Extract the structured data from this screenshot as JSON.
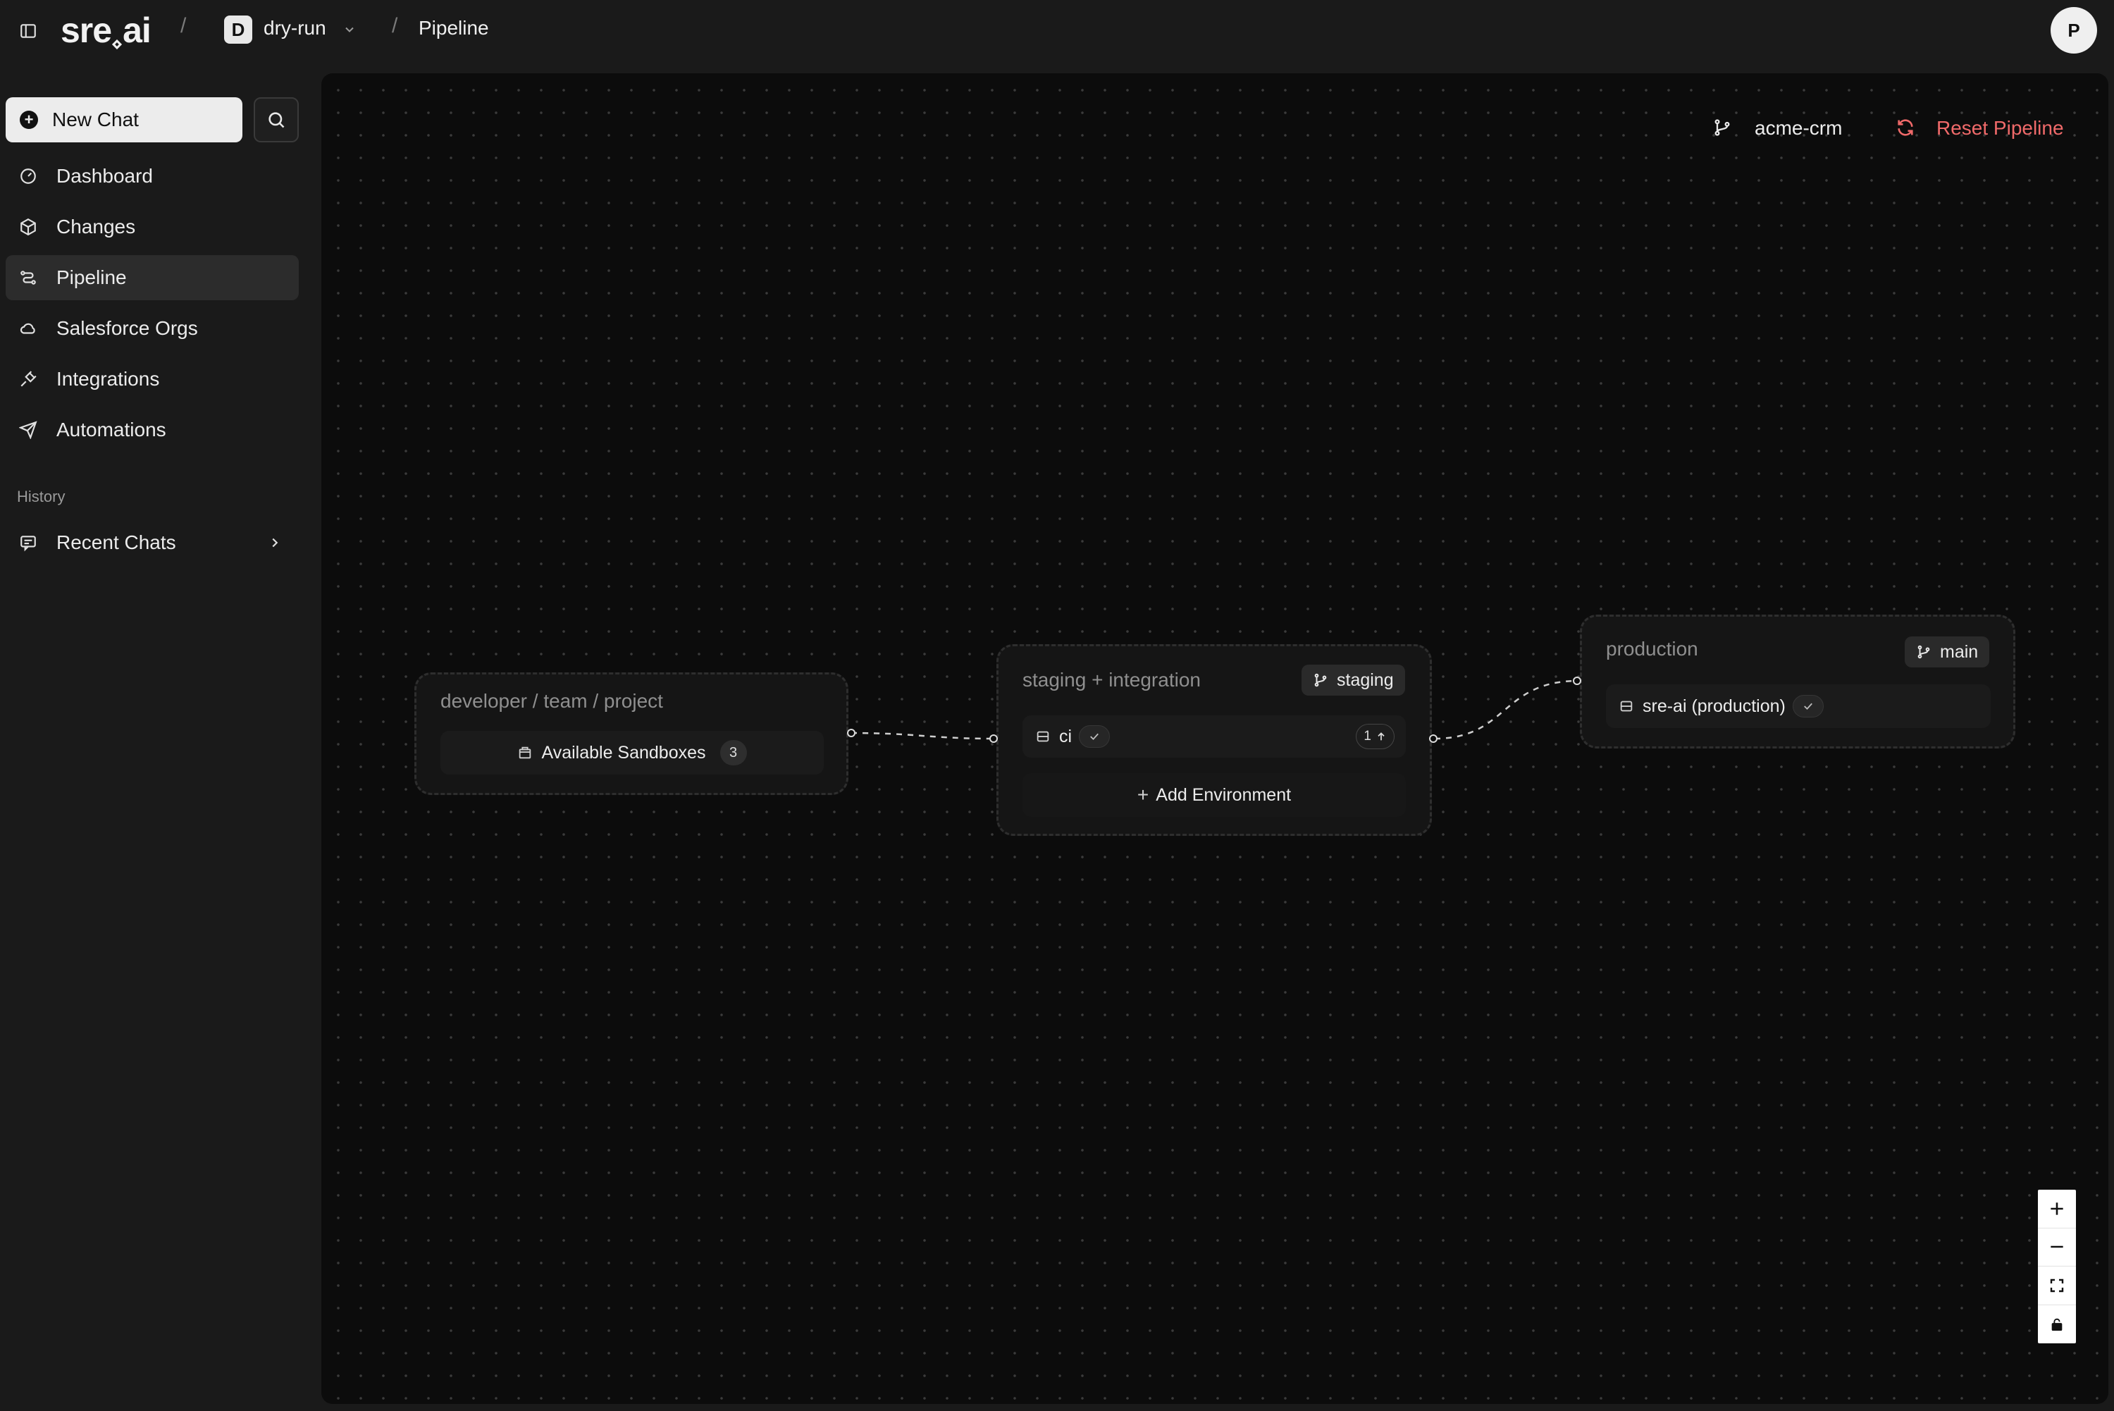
{
  "header": {
    "logo_text": "sre",
    "logo_suffix": "ai",
    "separator": "/",
    "workspace_initial": "D",
    "workspace_name": "dry-run",
    "page": "Pipeline",
    "avatar_initial": "P"
  },
  "sidebar": {
    "new_chat_label": "New Chat",
    "items": [
      {
        "label": "Dashboard",
        "icon": "gauge-icon"
      },
      {
        "label": "Changes",
        "icon": "package-icon"
      },
      {
        "label": "Pipeline",
        "icon": "pipeline-icon",
        "active": true
      },
      {
        "label": "Salesforce Orgs",
        "icon": "cloud-icon"
      },
      {
        "label": "Integrations",
        "icon": "plug-icon"
      },
      {
        "label": "Automations",
        "icon": "send-icon"
      }
    ],
    "history_label": "History",
    "recent_chats_label": "Recent Chats"
  },
  "canvas": {
    "repo_name": "acme-crm",
    "reset_label": "Reset Pipeline",
    "stages": [
      {
        "title": "developer / team / project",
        "rows": [
          {
            "label": "Available Sandboxes",
            "count": "3"
          }
        ]
      },
      {
        "title": "staging + integration",
        "branch": "staging",
        "rows": [
          {
            "label": "ci",
            "status": "check",
            "pending": "1"
          }
        ],
        "add_label": "Add Environment"
      },
      {
        "title": "production",
        "branch": "main",
        "rows": [
          {
            "label": "sre-ai (production)",
            "status": "check"
          }
        ]
      }
    ]
  },
  "colors": {
    "accent_danger": "#f06a6a",
    "canvas_bg": "#0c0c0c",
    "app_bg": "#1a1a1a"
  }
}
